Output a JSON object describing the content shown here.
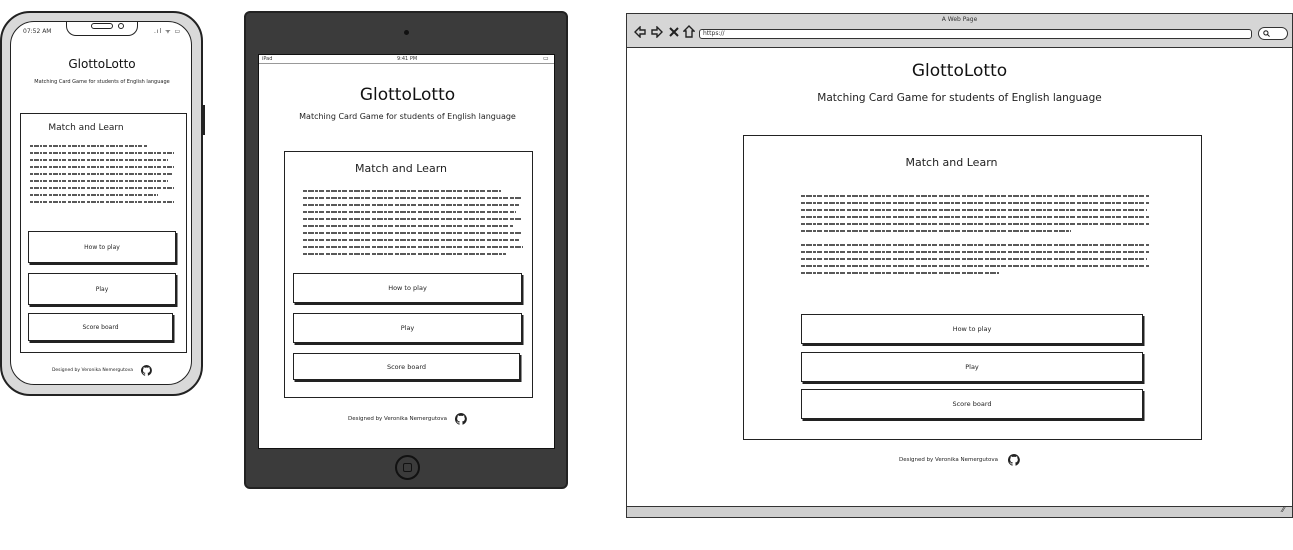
{
  "app": {
    "title": "GlottoLotto",
    "subtitle": "Matching Card Game for students of English language",
    "card_title": "Match and Learn",
    "buttons": [
      "How to play",
      "Play",
      "Score board"
    ],
    "footer": "Designed by Veronika Nemergutova",
    "footer_icon": "github-icon"
  },
  "phone": {
    "status_time": "07:52 AM"
  },
  "tablet": {
    "status_left": "iPad",
    "status_time": "9:41 PM"
  },
  "browser": {
    "window_title": "A Web Page",
    "url": "https://"
  },
  "colors": {
    "ink": "#222222",
    "device_frame": "#3b3b3b",
    "phone_body": "#d9d9d9",
    "browser_chrome": "#d6d6d6"
  }
}
